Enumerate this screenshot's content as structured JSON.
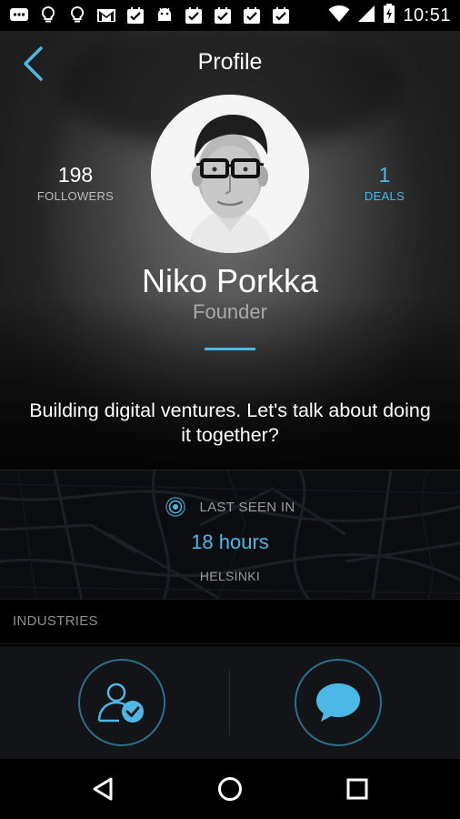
{
  "status_bar": {
    "time": "10:51",
    "left_icons": [
      "messages-icon",
      "bulb-icon",
      "bulb-icon",
      "gmail-icon",
      "check-icon",
      "android-icon",
      "check-icon",
      "check-icon",
      "check-icon",
      "check-icon"
    ],
    "right_icons": [
      "wifi-icon",
      "signal-icon",
      "battery-icon"
    ]
  },
  "header": {
    "title": "Profile"
  },
  "profile": {
    "name": "Niko Porkka",
    "role": "Founder",
    "bio": "Building digital ventures. Let's talk about doing it together?",
    "followers": {
      "value": "198",
      "label": "FOLLOWERS"
    },
    "deals": {
      "value": "1",
      "label": "DEALS"
    }
  },
  "last_seen": {
    "label": "LAST SEEN IN",
    "value": "18 hours",
    "city": "HELSINKI"
  },
  "industries": {
    "label": "INDUSTRIES"
  },
  "actions": [
    "follow-button",
    "message-button"
  ],
  "colors": {
    "accent": "#4cb8e6",
    "background": "#000000",
    "action_bar": "#121417"
  }
}
